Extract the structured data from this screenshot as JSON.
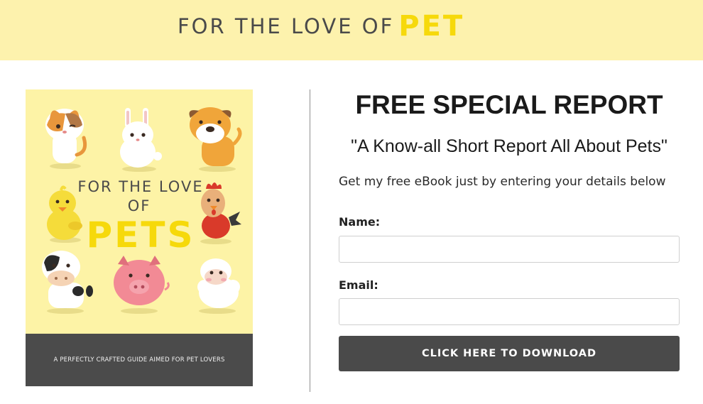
{
  "header": {
    "brand_main": "FOR THE LOVE OF",
    "brand_accent": "PET",
    "bg_color": "#fdf2ad",
    "accent_color": "#f6d90b"
  },
  "ebook": {
    "cover_title_line1": "FOR THE LOVE",
    "cover_title_line2": "OF",
    "cover_title_line3": "PETS",
    "cover_tagline": "A PERFECTLY CRAFTED GUIDE AIMED FOR PET LOVERS",
    "animals": [
      "cat-icon",
      "rabbit-icon",
      "dog-icon",
      "chick-icon",
      "rooster-icon",
      "cow-icon",
      "pig-icon",
      "sheep-icon"
    ]
  },
  "optin": {
    "title": "FREE SPECIAL REPORT",
    "subtitle": "\"A Know-all Short Report All About Pets\"",
    "intro": "Get my free eBook just by entering your details below",
    "name_label": "Name:",
    "name_value": "",
    "email_label": "Email:",
    "email_value": "",
    "cta_label": "CLICK HERE TO DOWNLOAD",
    "cta_color": "#4a4a4a"
  }
}
